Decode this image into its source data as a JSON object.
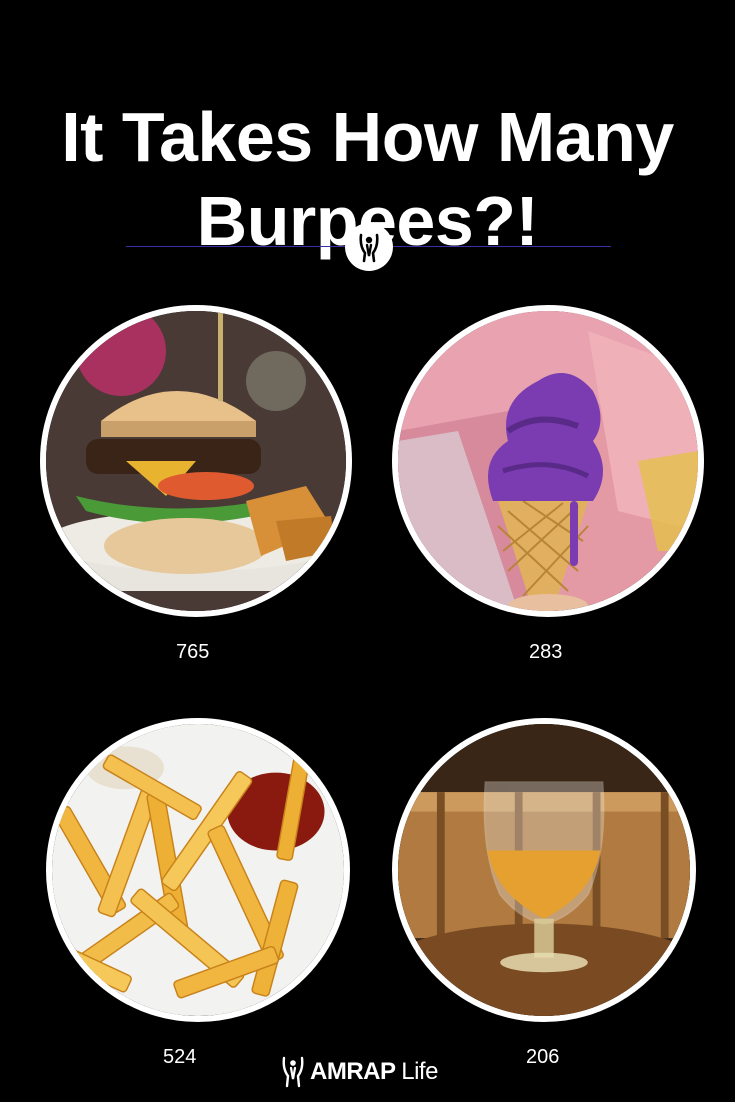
{
  "title": {
    "line1": "It Takes How Many",
    "line2": "Burpees?!"
  },
  "items": [
    {
      "food": "burger",
      "count": "765"
    },
    {
      "food": "ice-cream-cone",
      "count": "283"
    },
    {
      "food": "french-fries",
      "count": "524"
    },
    {
      "food": "beer-glass",
      "count": "206"
    }
  ],
  "brand": {
    "name_bold": "AMRAP",
    "name_light": "Life",
    "icon": "amrap-figure-icon"
  },
  "colors": {
    "background": "#000000",
    "text": "#ffffff",
    "divider": "#3a2fa8"
  }
}
